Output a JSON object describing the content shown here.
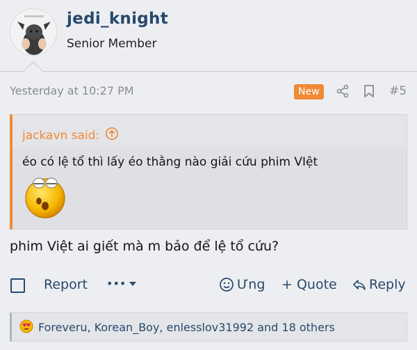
{
  "author": {
    "username": "jedi_knight",
    "user_title": "Senior Member"
  },
  "meta": {
    "timestamp": "Yesterday at 10:27 PM",
    "badge": "New",
    "post_number": "#5"
  },
  "quote": {
    "author_said": "jackavn said:",
    "text": "éo có lệ tổ thì lấy éo thằng nào giải cứu phim VIệt"
  },
  "post": {
    "text": "phim Việt ai giết mà m bảo để lệ tổ cứu?"
  },
  "actions": {
    "report": "Report",
    "more": "•••",
    "react": "Ưng",
    "quote": "+ Quote",
    "reply": "Reply"
  },
  "reactions": {
    "text": "Foreveru, Korean_Boy, enlesslov31992 and 18 others"
  },
  "colors": {
    "accent_orange": "#f08a36",
    "link_blue": "#27496d",
    "background": "#edeef1"
  }
}
